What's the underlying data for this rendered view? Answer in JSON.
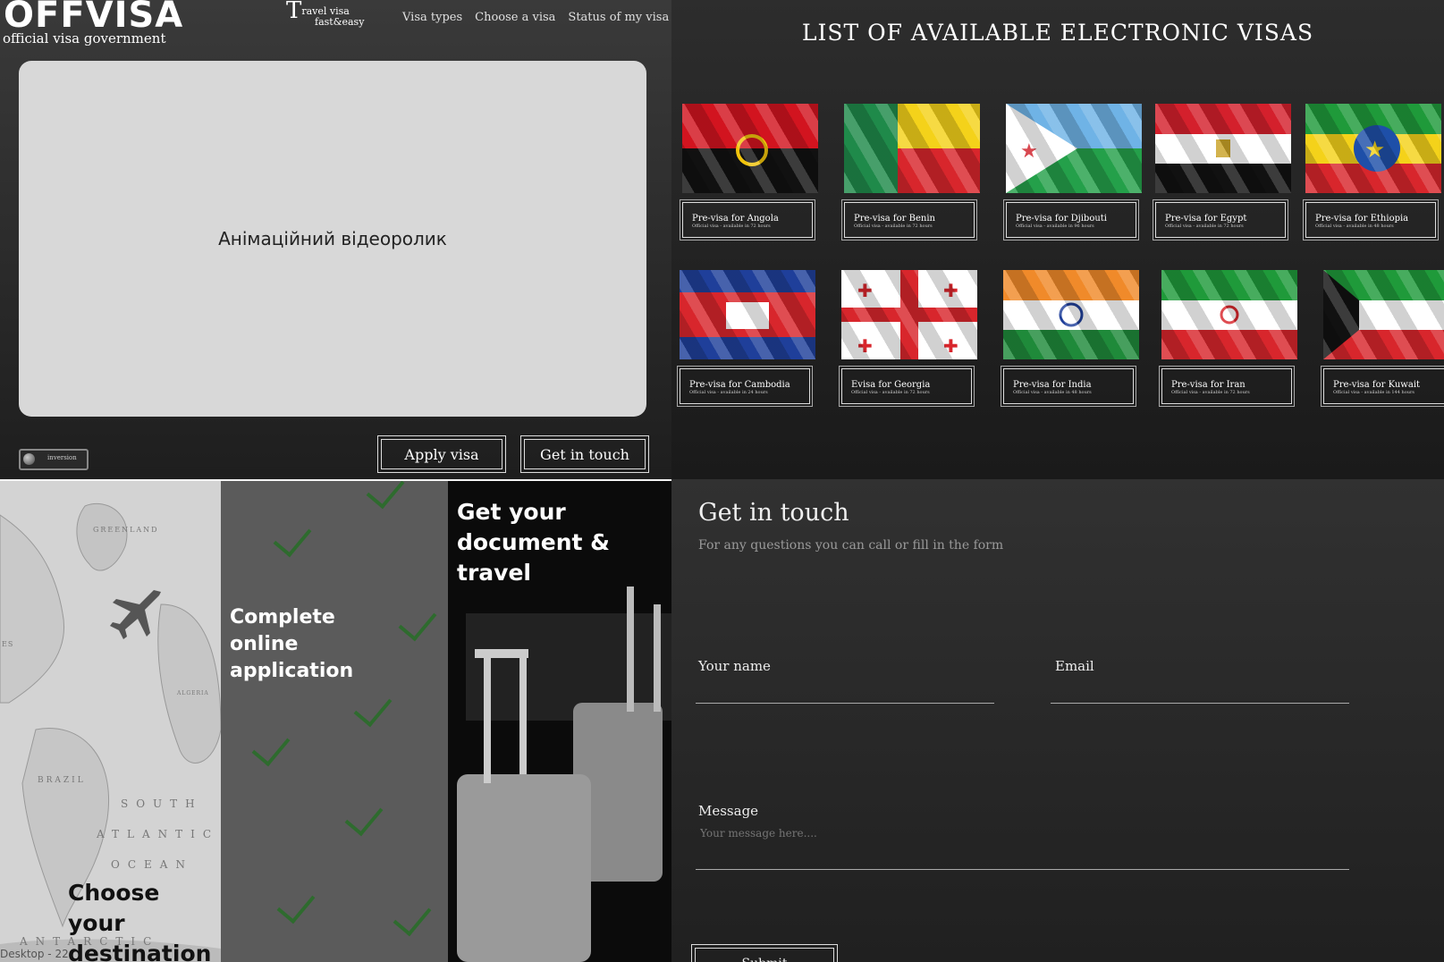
{
  "header": {
    "logo": "OFFVISA",
    "logo_sub": "official visa government",
    "tagline_big": "T",
    "tagline_rest": "ravel  visa",
    "tagline_line2": "fast&easy",
    "nav": [
      "Visa types",
      "Choose a visa",
      "Status of my visa"
    ]
  },
  "hero": {
    "video_placeholder": "Анімаційний відеоролик",
    "toggle_label": "inversion",
    "apply_button": "Apply visa",
    "contact_button": "Get in touch"
  },
  "visa_list": {
    "title": "LIST OF AVAILABLE ELECTRONIC VISAS",
    "cards": [
      {
        "label": "Pre-visa for Angola",
        "sub": "Official visa - available in 72 hours",
        "flag": "angola"
      },
      {
        "label": "Pre-visa for Benin",
        "sub": "Official visa - available in 72 hours",
        "flag": "benin"
      },
      {
        "label": "Pre-visa for Djibouti",
        "sub": "Official visa - available in 96 hours",
        "flag": "djibouti"
      },
      {
        "label": "Pre-visa for Egypt",
        "sub": "Official visa - available in 72 hours",
        "flag": "egypt"
      },
      {
        "label": "Pre-visa for Ethiopia",
        "sub": "Official visa - available in 48 hours",
        "flag": "ethiopia"
      },
      {
        "label": "Pre-visa for Cambodia",
        "sub": "Official visa - available in 24 hours",
        "flag": "cambodia"
      },
      {
        "label": "Evisa for Georgia",
        "sub": "Official visa - available in 72 hours",
        "flag": "georgia"
      },
      {
        "label": "Pre-visa for India",
        "sub": "Official visa - available in 48 hours",
        "flag": "india"
      },
      {
        "label": "Pre-visa for Iran",
        "sub": "Official visa - available in 72 hours",
        "flag": "iran"
      },
      {
        "label": "Pre-visa for Kuwait",
        "sub": "Official visa - available in 144 hours",
        "flag": "kuwait"
      }
    ]
  },
  "steps": {
    "step1": "Choose your destination",
    "step2": "Complete online application",
    "step3": "Get your document & travel",
    "map_labels": [
      "GREENLAND",
      "BRAZIL",
      "SOUTH",
      "ATLANTIC",
      "OCEAN",
      "ANTARCTIC",
      "ALGERIA",
      "ES"
    ],
    "frame_label": "Desktop - 22"
  },
  "contact": {
    "title": "Get in touch",
    "subtitle": "For any questions you can call or fill in the form",
    "name_label": "Your name",
    "email_label": "Email",
    "message_label": "Message",
    "message_placeholder": "Your message here....",
    "submit": "Submit"
  },
  "colors": {
    "check_green": "#2e6b2e",
    "video_bg": "#d8d8d8"
  }
}
